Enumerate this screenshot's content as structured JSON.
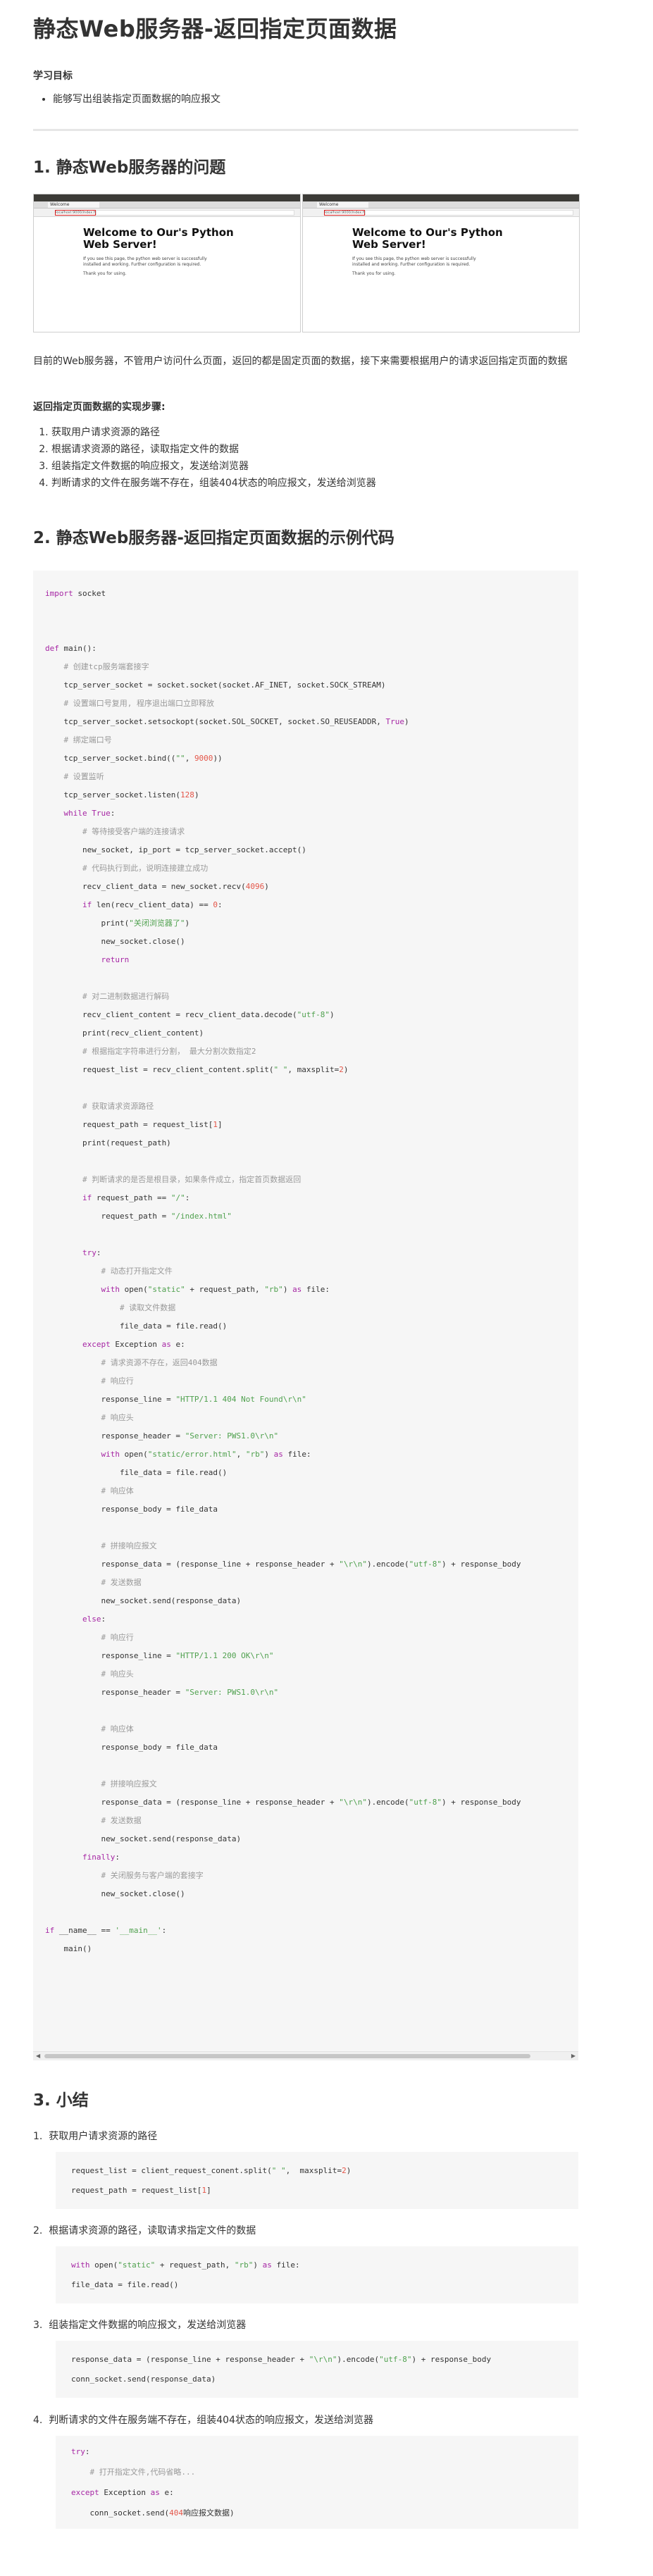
{
  "title": "静态Web服务器-返回指定页面数据",
  "objectives": {
    "heading": "学习目标",
    "items": [
      "能够写出组装指定页面数据的响应报文"
    ]
  },
  "section1": {
    "heading": "1. 静态Web服务器的问题",
    "browser_shot": {
      "tab_label": "Welcome",
      "url": "localhost:9000/index.html",
      "page_title": "Welcome to Our's Python Web Server!",
      "page_text": "If you see this page, the python web server is successfully installed and working. Further configuration is required.",
      "thanks": "Thank you for using."
    },
    "paragraph": "目前的Web服务器，不管用户访问什么页面，返回的都是固定页面的数据，接下来需要根据用户的请求返回指定页面的数据",
    "steps_label": "返回指定页面数据的实现步骤:",
    "steps": [
      "获取用户请求资源的路径",
      "根据请求资源的路径，读取指定文件的数据",
      "组装指定文件数据的响应报文，发送给浏览器",
      "判断请求的文件在服务端不存在，组装404状态的响应报文，发送给浏览器"
    ]
  },
  "section2": {
    "heading": "2. 静态Web服务器-返回指定页面数据的示例代码",
    "code_lines": [
      "import socket",
      "",
      "",
      "def main():",
      "    # 创建tcp服务端套接字",
      "    tcp_server_socket = socket.socket(socket.AF_INET, socket.SOCK_STREAM)",
      "    # 设置端口号复用, 程序退出端口立即释放",
      "    tcp_server_socket.setsockopt(socket.SOL_SOCKET, socket.SO_REUSEADDR, True)",
      "    # 绑定端口号",
      "    tcp_server_socket.bind((\"\", 9000))",
      "    # 设置监听",
      "    tcp_server_socket.listen(128)",
      "    while True:",
      "        # 等待接受客户端的连接请求",
      "        new_socket, ip_port = tcp_server_socket.accept()",
      "        # 代码执行到此，说明连接建立成功",
      "        recv_client_data = new_socket.recv(4096)",
      "        if len(recv_client_data) == 0:",
      "            print(\"关闭浏览器了\")",
      "            new_socket.close()",
      "            return",
      "",
      "        # 对二进制数据进行解码",
      "        recv_client_content = recv_client_data.decode(\"utf-8\")",
      "        print(recv_client_content)",
      "        # 根据指定字符串进行分割， 最大分割次数指定2",
      "        request_list = recv_client_content.split(\" \", maxsplit=2)",
      "",
      "        # 获取请求资源路径",
      "        request_path = request_list[1]",
      "        print(request_path)",
      "",
      "        # 判断请求的是否是根目录，如果条件成立，指定首页数据返回",
      "        if request_path == \"/\":",
      "            request_path = \"/index.html\"",
      "",
      "        try:",
      "            # 动态打开指定文件",
      "            with open(\"static\" + request_path, \"rb\") as file:",
      "                # 读取文件数据",
      "                file_data = file.read()",
      "        except Exception as e:",
      "            # 请求资源不存在，返回404数据",
      "            # 响应行",
      "            response_line = \"HTTP/1.1 404 Not Found\\r\\n\"",
      "            # 响应头",
      "            response_header = \"Server: PWS1.0\\r\\n\"",
      "            with open(\"static/error.html\", \"rb\") as file:",
      "                file_data = file.read()",
      "            # 响应体",
      "            response_body = file_data",
      "",
      "            # 拼接响应报文",
      "            response_data = (response_line + response_header + \"\\r\\n\").encode(\"utf-8\") + response_body",
      "            # 发送数据",
      "            new_socket.send(response_data)",
      "        else:",
      "            # 响应行",
      "            response_line = \"HTTP/1.1 200 OK\\r\\n\"",
      "            # 响应头",
      "            response_header = \"Server: PWS1.0\\r\\n\"",
      "",
      "            # 响应体",
      "            response_body = file_data",
      "",
      "            # 拼接响应报文",
      "            response_data = (response_line + response_header + \"\\r\\n\").encode(\"utf-8\") + response_body",
      "            # 发送数据",
      "            new_socket.send(response_data)",
      "        finally:",
      "            # 关闭服务与客户端的套接字",
      "            new_socket.close()",
      "",
      "if __name__ == '__main__':",
      "    main()"
    ]
  },
  "section3": {
    "heading": "3. 小结",
    "items": [
      {
        "label": "获取用户请求资源的路径",
        "code": [
          "request_list = client_request_conent.split(\" \",  maxsplit=2)",
          "request_path = request_list[1]"
        ]
      },
      {
        "label": "根据请求资源的路径，读取请求指定文件的数据",
        "code": [
          "with open(\"static\" + request_path, \"rb\") as file:",
          "file_data = file.read()"
        ]
      },
      {
        "label": "组装指定文件数据的响应报文，发送给浏览器",
        "code": [
          "response_data = (response_line + response_header + \"\\r\\n\").encode(\"utf-8\") + response_body",
          "conn_socket.send(response_data)"
        ]
      },
      {
        "label": "判断请求的文件在服务端不存在，组装404状态的响应报文，发送给浏览器",
        "code": [
          "try:",
          "    # 打开指定文件,代码省略...",
          "except Exception as e:",
          "    conn_socket.send(404响应报文数据)"
        ]
      }
    ]
  }
}
